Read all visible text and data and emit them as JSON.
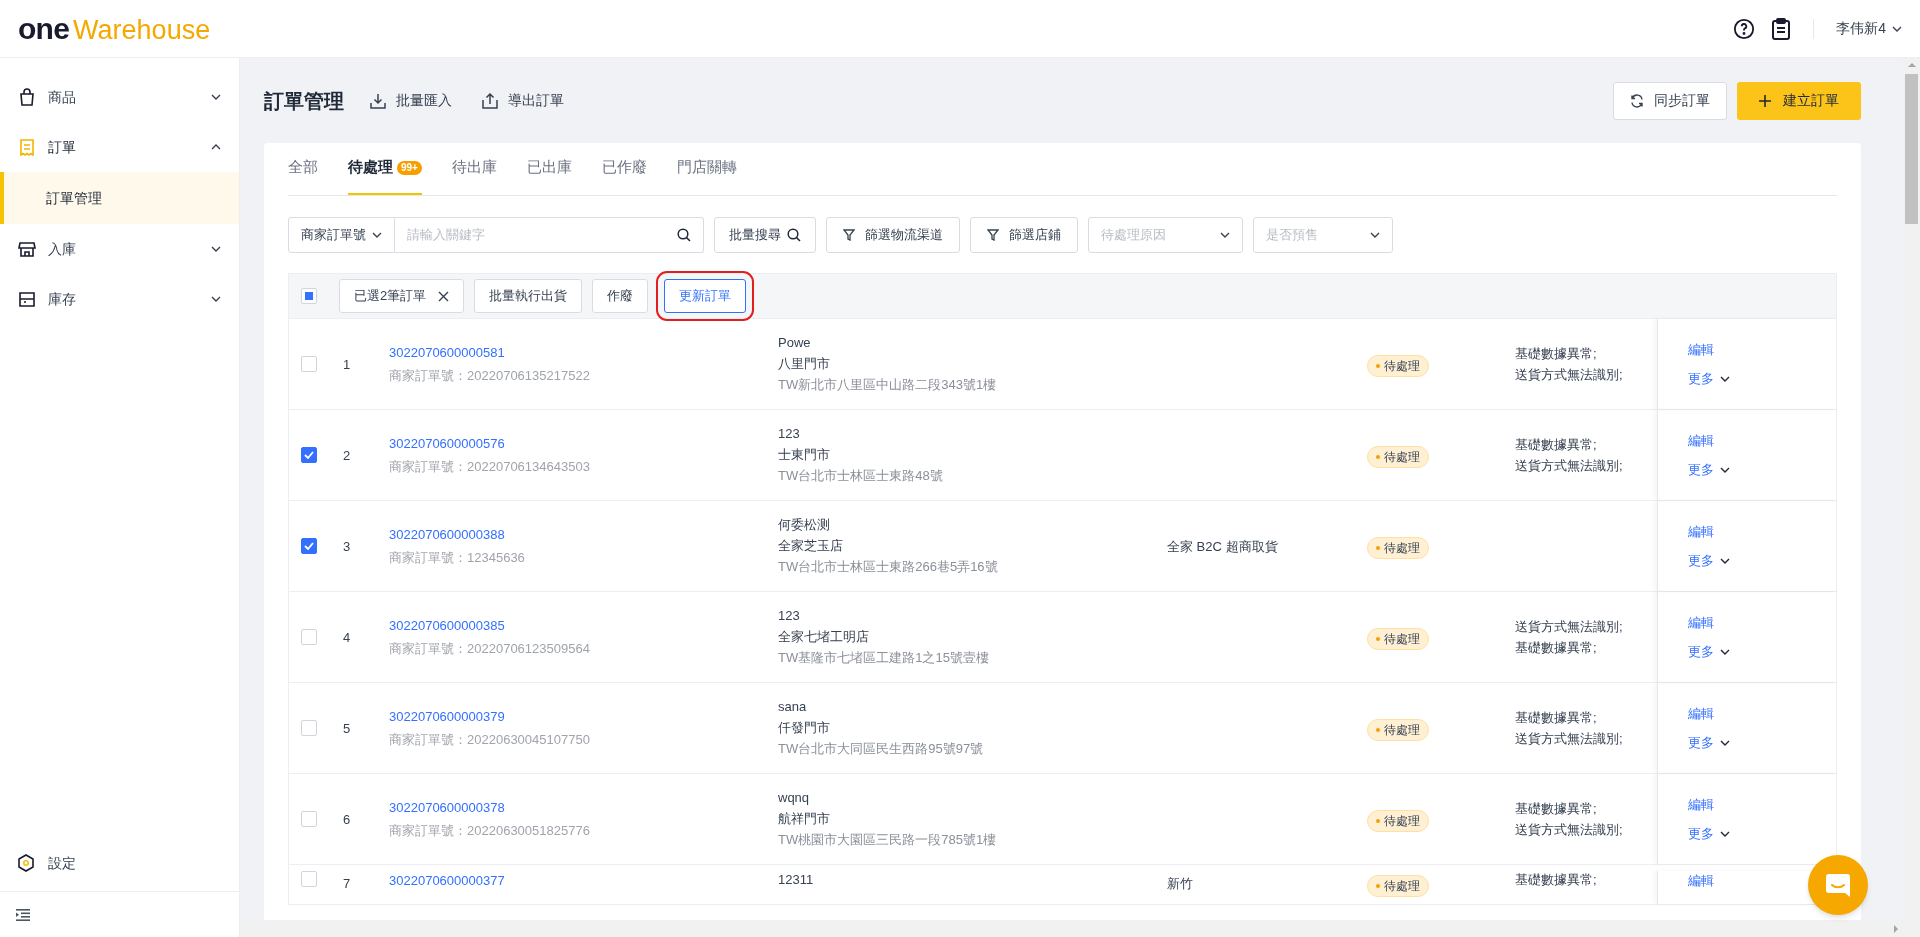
{
  "header": {
    "logo_primary": "one",
    "logo_secondary": "Warehouse",
    "user": "李伟新4"
  },
  "sidebar": {
    "items": [
      {
        "label": "商品",
        "kind": "bag",
        "expanded": false
      },
      {
        "label": "訂單",
        "kind": "receipt",
        "expanded": true,
        "children": [
          {
            "label": "訂單管理",
            "selected": true
          }
        ]
      },
      {
        "label": "入庫",
        "kind": "store",
        "expanded": false
      },
      {
        "label": "庫存",
        "kind": "shelf",
        "expanded": false
      }
    ],
    "settings": "設定"
  },
  "page": {
    "title": "訂單管理",
    "actions": [
      {
        "label": "批量匯入",
        "kind": "download"
      },
      {
        "label": "導出訂單",
        "kind": "upload"
      }
    ],
    "buttons": [
      {
        "label": "同步訂單",
        "kind": "secondary"
      },
      {
        "label": "建立訂單",
        "kind": "primary"
      }
    ]
  },
  "tabs": [
    {
      "label": "全部",
      "selected": false
    },
    {
      "label": "待處理",
      "badge": "99+",
      "selected": true
    },
    {
      "label": "待出庫",
      "selected": false
    },
    {
      "label": "已出庫",
      "selected": false
    },
    {
      "label": "已作廢",
      "selected": false
    },
    {
      "label": "門店關轉",
      "selected": false
    }
  ],
  "filters": {
    "field_select": "商家訂單號",
    "search_placeholder": "請輸入關鍵字",
    "batch_search": "批量搜尋",
    "filter_buttons": [
      "篩選物流渠道",
      "篩選店鋪"
    ],
    "dropdowns": [
      {
        "placeholder": "待處理原因"
      },
      {
        "placeholder": "是否預售"
      }
    ]
  },
  "batch_bar": {
    "indeterminate": true,
    "selected_chip": "已選2筆訂單",
    "buttons": [
      {
        "label": "批量執行出貨",
        "highlighted": false
      },
      {
        "label": "作廢",
        "highlighted": false
      },
      {
        "label": "更新訂單",
        "highlighted": true
      }
    ]
  },
  "rows": [
    {
      "checked": false,
      "index": "1",
      "order_no": "3022070600000581",
      "merchant_no": "商家訂單號：20220706135217522",
      "recipient": [
        "Powe",
        "八里門市",
        "TW新北市八里區中山路二段343號1樓"
      ],
      "status": "待處理",
      "reasons": [
        "基礎數據異常;",
        "送貨方式無法識別;"
      ],
      "edit": "編輯",
      "more": "更多"
    },
    {
      "checked": true,
      "index": "2",
      "order_no": "3022070600000576",
      "merchant_no": "商家訂單號：20220706134643503",
      "recipient": [
        "123",
        "士東門市",
        "TW台北市士林區士東路48號"
      ],
      "status": "待處理",
      "reasons": [
        "基礎數據異常;",
        "送貨方式無法識別;"
      ],
      "edit": "編輯",
      "more": "更多"
    },
    {
      "checked": true,
      "index": "3",
      "order_no": "3022070600000388",
      "merchant_no": "商家訂單號：12345636",
      "recipient": [
        "何委松测",
        "全家芝玉店",
        "TW台北市士林區士東路266巷5弄16號"
      ],
      "logistics": "全家 B2C 超商取貨",
      "status": "待處理",
      "edit": "編輯",
      "more": "更多"
    },
    {
      "checked": false,
      "index": "4",
      "order_no": "3022070600000385",
      "merchant_no": "商家訂單號：20220706123509564",
      "recipient": [
        "123",
        "全家七堵工明店",
        "TW基隆市七堵區工建路1之15號壹樓"
      ],
      "status": "待處理",
      "reasons": [
        "送貨方式無法識別;",
        "基礎數據異常;"
      ],
      "edit": "編輯",
      "more": "更多"
    },
    {
      "checked": false,
      "index": "5",
      "order_no": "3022070600000379",
      "merchant_no": "商家訂單號：20220630045107750",
      "recipient": [
        "sana",
        "仟發門市",
        "TW台北市大同區民生西路95號97號"
      ],
      "status": "待處理",
      "reasons": [
        "基礎數據異常;",
        "送貨方式無法識別;"
      ],
      "edit": "編輯",
      "more": "更多"
    },
    {
      "checked": false,
      "index": "6",
      "order_no": "3022070600000378",
      "merchant_no": "商家訂單號：20220630051825776",
      "recipient": [
        "wqnq",
        "航祥門市",
        "TW桃園市大園區三民路一段785號1樓"
      ],
      "status": "待處理",
      "reasons": [
        "基礎數據異常;",
        "送貨方式無法識別;"
      ],
      "edit": "編輯",
      "more": "更多"
    },
    {
      "checked": false,
      "index": "7",
      "order_no": "3022070600000377",
      "recipient": [
        "12311"
      ],
      "logistics": "新竹",
      "status": "待處理",
      "reasons": [
        "基礎數據異常;"
      ],
      "edit": "編輯"
    }
  ]
}
